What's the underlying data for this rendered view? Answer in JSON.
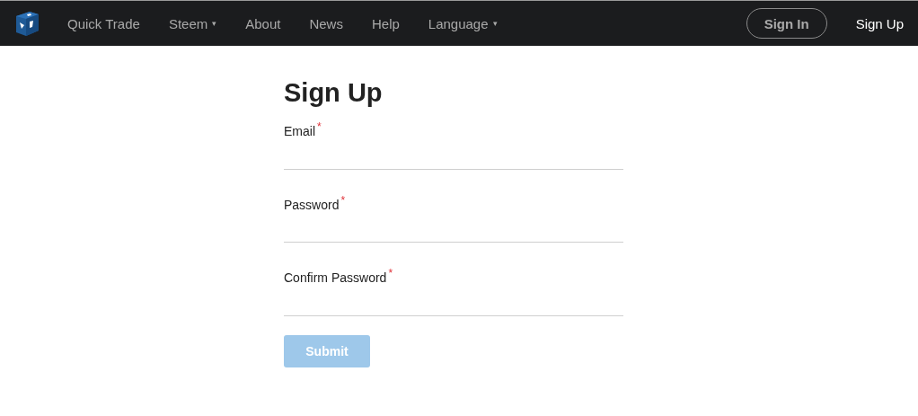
{
  "nav": {
    "items": [
      {
        "label": "Quick Trade"
      },
      {
        "label": "Steem",
        "caret": "▾"
      },
      {
        "label": "About"
      },
      {
        "label": "News"
      },
      {
        "label": "Help"
      },
      {
        "label": "Language",
        "caret": "▾"
      }
    ],
    "sign_in": "Sign In",
    "sign_up": "Sign Up"
  },
  "form": {
    "title": "Sign Up",
    "fields": [
      {
        "label": "Email",
        "required_mark": "*"
      },
      {
        "label": "Password",
        "required_mark": "*"
      },
      {
        "label": "Confirm Password",
        "required_mark": "*"
      }
    ],
    "submit": {
      "label": "Submit",
      "disabled": true
    }
  }
}
